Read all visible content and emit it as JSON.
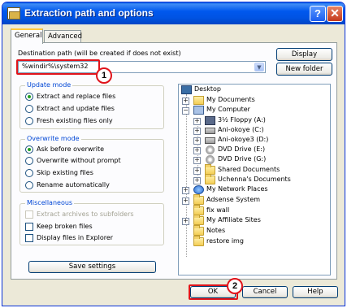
{
  "window": {
    "title": "Extraction path and options",
    "help_glyph": "?",
    "close_glyph": "✕"
  },
  "tabs": [
    {
      "label": "General",
      "active": true
    },
    {
      "label": "Advanced",
      "active": false
    }
  ],
  "destination": {
    "label": "Destination path (will be created if does not exist)",
    "value": "%windir%\\system32",
    "arrow": "▼"
  },
  "buttons": {
    "display": "Display",
    "new_folder": "New folder",
    "save_settings": "Save settings",
    "ok": "OK",
    "cancel": "Cancel",
    "help": "Help"
  },
  "update_mode": {
    "title": "Update mode",
    "options": [
      {
        "label": "Extract and replace files",
        "selected": true
      },
      {
        "label": "Extract and update files",
        "selected": false
      },
      {
        "label": "Fresh existing files only",
        "selected": false
      }
    ]
  },
  "overwrite_mode": {
    "title": "Overwrite mode",
    "options": [
      {
        "label": "Ask before overwrite",
        "selected": true
      },
      {
        "label": "Overwrite without prompt",
        "selected": false
      },
      {
        "label": "Skip existing files",
        "selected": false
      },
      {
        "label": "Rename automatically",
        "selected": false
      }
    ]
  },
  "miscellaneous": {
    "title": "Miscellaneous",
    "options": [
      {
        "label": "Extract archives to subfolders",
        "checked": false,
        "disabled": true
      },
      {
        "label": "Keep broken files",
        "checked": false,
        "disabled": false
      },
      {
        "label": "Display files in Explorer",
        "checked": false,
        "disabled": false
      }
    ]
  },
  "tree": [
    {
      "label": "Desktop",
      "icon": "desktop-icon"
    },
    {
      "label": "My Documents",
      "icon": "my-documents-icon"
    },
    {
      "label": "My Computer",
      "icon": "my-computer-icon"
    },
    {
      "label": "3½ Floppy (A:)",
      "icon": "floppy-icon"
    },
    {
      "label": "Ani-okoye (C:)",
      "icon": "hard-drive-icon"
    },
    {
      "label": "Ani-okoye3 (D:)",
      "icon": "hard-drive-icon"
    },
    {
      "label": "DVD Drive (E:)",
      "icon": "dvd-icon"
    },
    {
      "label": "DVD Drive (G:)",
      "icon": "dvd-icon"
    },
    {
      "label": "Shared Documents",
      "icon": "folder-icon"
    },
    {
      "label": "Uchenna's Documents",
      "icon": "folder-icon"
    },
    {
      "label": "My Network Places",
      "icon": "network-icon"
    },
    {
      "label": "Adsense System",
      "icon": "folder-icon"
    },
    {
      "label": "fix wall",
      "icon": "folder-icon"
    },
    {
      "label": "My Affiliate Sites",
      "icon": "folder-icon"
    },
    {
      "label": "Notes",
      "icon": "folder-icon"
    },
    {
      "label": "restore img",
      "icon": "folder-icon"
    }
  ],
  "expanders": {
    "plus": "+",
    "minus": "−"
  },
  "annotations": {
    "step1": "1",
    "step2": "2",
    "color": "#e0141b"
  }
}
